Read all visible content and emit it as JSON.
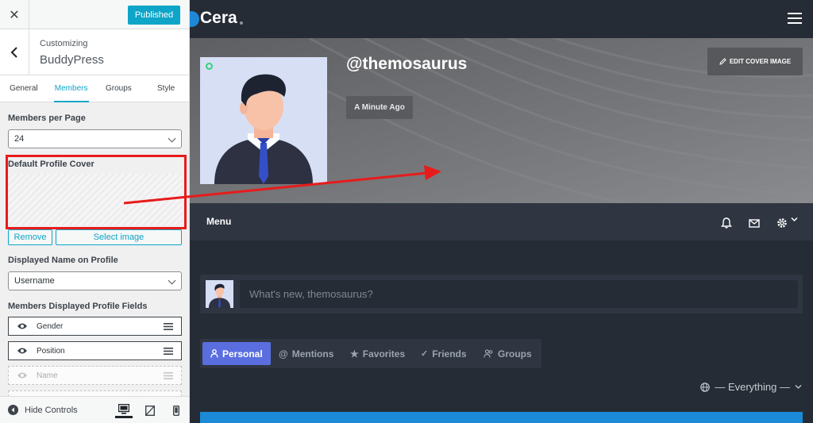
{
  "panel": {
    "close_label": "✕",
    "publish_label": "Published",
    "breadcrumb": "Customizing",
    "section_title": "BuddyPress",
    "tabs": [
      {
        "label": "General",
        "active": false
      },
      {
        "label": "Members",
        "active": true
      },
      {
        "label": "Groups",
        "active": false
      },
      {
        "label": "Style",
        "active": false
      }
    ],
    "members_per_page": {
      "label": "Members per Page",
      "value": "24"
    },
    "default_cover": {
      "label": "Default Profile Cover",
      "remove_label": "Remove",
      "select_label": "Select image"
    },
    "displayed_name": {
      "label": "Displayed Name on Profile",
      "value": "Username"
    },
    "profile_fields": {
      "label": "Members Displayed Profile Fields",
      "items": [
        {
          "name": "Gender",
          "visible": true
        },
        {
          "name": "Position",
          "visible": true
        },
        {
          "name": "Name",
          "visible": false
        }
      ]
    },
    "hide_controls_label": "Hide Controls",
    "devices": [
      "desktop-icon",
      "tablet-icon",
      "mobile-icon"
    ]
  },
  "site": {
    "logo_text": "Cera",
    "username": "@themosaurus",
    "last_active": "A Minute Ago",
    "edit_cover_label": "EDIT COVER IMAGE",
    "menu_label": "Menu",
    "post_placeholder": "What's new, themosaurus?",
    "activity_tabs": [
      {
        "label": "Personal",
        "icon": "person-icon",
        "active": true
      },
      {
        "label": "Mentions",
        "icon": "at-icon",
        "active": false
      },
      {
        "label": "Favorites",
        "icon": "star-icon",
        "active": false
      },
      {
        "label": "Friends",
        "icon": "check-icon",
        "active": false
      },
      {
        "label": "Groups",
        "icon": "group-icon",
        "active": false
      }
    ],
    "scope_label": "— Everything —"
  },
  "colors": {
    "accent": "#0ea5c8",
    "highlight_red": "#e81b1b",
    "site_bg": "#262c35",
    "tab_active": "#5a6ee0"
  }
}
